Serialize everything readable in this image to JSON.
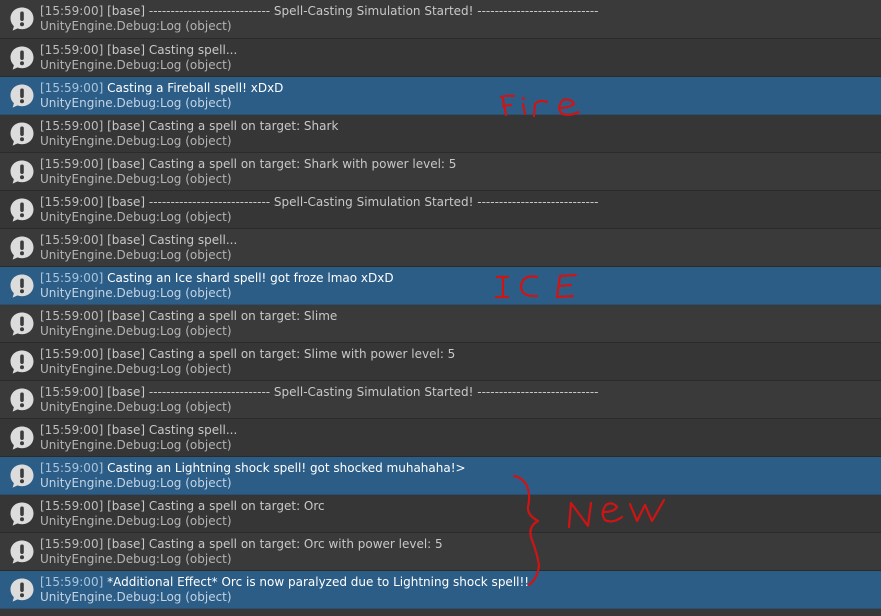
{
  "console": {
    "colors": {
      "row_odd": "#3a3a3a",
      "row_even": "#363636",
      "selected": "#2c5d87",
      "annotation_ink": "#d01414"
    },
    "icon": "info-bubble-icon",
    "entries": [
      {
        "time": "[15:59:00]",
        "text": " [base] ---------------------------- Spell-Casting Simulation Started! ----------------------------",
        "source": "UnityEngine.Debug:Log (object)",
        "selected": false
      },
      {
        "time": "[15:59:00]",
        "text": " [base] Casting spell...",
        "source": "UnityEngine.Debug:Log (object)",
        "selected": false
      },
      {
        "time": "[15:59:00]",
        "text": " Casting a Fireball spell! xDxD",
        "source": "UnityEngine.Debug:Log (object)",
        "selected": true
      },
      {
        "time": "[15:59:00]",
        "text": " [base] Casting a spell on target: Shark",
        "source": "UnityEngine.Debug:Log (object)",
        "selected": false
      },
      {
        "time": "[15:59:00]",
        "text": " [base] Casting a spell on target: Shark with power level: 5",
        "source": "UnityEngine.Debug:Log (object)",
        "selected": false
      },
      {
        "time": "[15:59:00]",
        "text": " [base] ---------------------------- Spell-Casting Simulation Started! ----------------------------",
        "source": "UnityEngine.Debug:Log (object)",
        "selected": false
      },
      {
        "time": "[15:59:00]",
        "text": " [base] Casting spell...",
        "source": "UnityEngine.Debug:Log (object)",
        "selected": false
      },
      {
        "time": "[15:59:00]",
        "text": " Casting an Ice shard spell! got froze lmao xDxD",
        "source": "UnityEngine.Debug:Log (object)",
        "selected": true
      },
      {
        "time": "[15:59:00]",
        "text": " [base] Casting a spell on target: Slime",
        "source": "UnityEngine.Debug:Log (object)",
        "selected": false
      },
      {
        "time": "[15:59:00]",
        "text": " [base] Casting a spell on target: Slime with power level: 5",
        "source": "UnityEngine.Debug:Log (object)",
        "selected": false
      },
      {
        "time": "[15:59:00]",
        "text": " [base] ---------------------------- Spell-Casting Simulation Started! ----------------------------",
        "source": "UnityEngine.Debug:Log (object)",
        "selected": false
      },
      {
        "time": "[15:59:00]",
        "text": " [base] Casting spell...",
        "source": "UnityEngine.Debug:Log (object)",
        "selected": false
      },
      {
        "time": "[15:59:00]",
        "text": " Casting an Lightning shock spell! got shocked muhahaha!>",
        "source": "UnityEngine.Debug:Log (object)",
        "selected": true
      },
      {
        "time": "[15:59:00]",
        "text": " [base] Casting a spell on target: Orc",
        "source": "UnityEngine.Debug:Log (object)",
        "selected": false
      },
      {
        "time": "[15:59:00]",
        "text": " [base] Casting a spell on target: Orc with power level: 5",
        "source": "UnityEngine.Debug:Log (object)",
        "selected": false
      },
      {
        "time": "[15:59:00]",
        "text": " *Additional Effect* Orc is now paralyzed due to Lightning shock spell!!",
        "source": "UnityEngine.Debug:Log (object)",
        "selected": true
      }
    ]
  },
  "annotations": {
    "fire": "Fire",
    "ice": "ICE",
    "new": "New"
  }
}
